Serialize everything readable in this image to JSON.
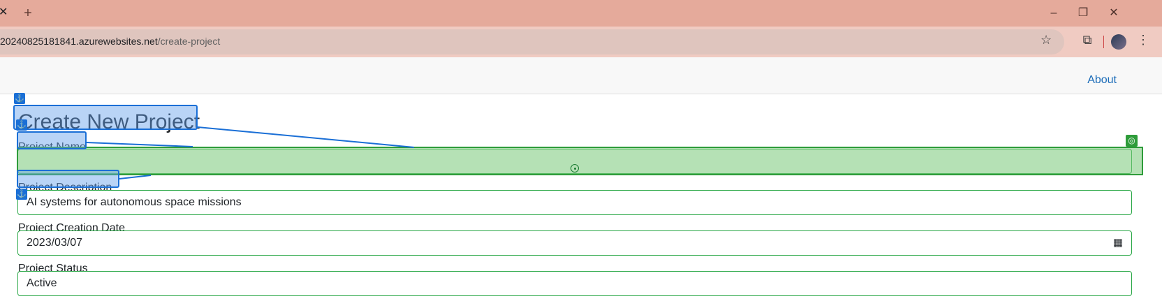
{
  "browser": {
    "tab_close": "✕",
    "new_tab": "+",
    "url_host": "20240825181841.azurewebsites.net",
    "url_path": "/create-project",
    "window_controls": [
      "–",
      "❐",
      "✕"
    ],
    "icons": [
      "star-icon",
      "extensions-icon",
      "avatar",
      "menu-icon"
    ]
  },
  "navbar": {
    "about": "About"
  },
  "form": {
    "title": "Create New Project",
    "project_name_label": "Project Name",
    "project_name_value": "",
    "project_description_label": "Project Description",
    "project_description_value": "AI systems for autonomous space missions",
    "creation_date_label": "Project Creation Date",
    "creation_date_value": "2023/03/07",
    "status_label": "Project Status",
    "status_value": "Active"
  },
  "colors": {
    "tabstrip": "#e5aa9b",
    "toolbar": "#f0cbc2",
    "valid_border": "#28a745",
    "link": "#1a6bb8",
    "annotation_blue": "#1a6fd6",
    "annotation_green": "#2e9c3a"
  }
}
